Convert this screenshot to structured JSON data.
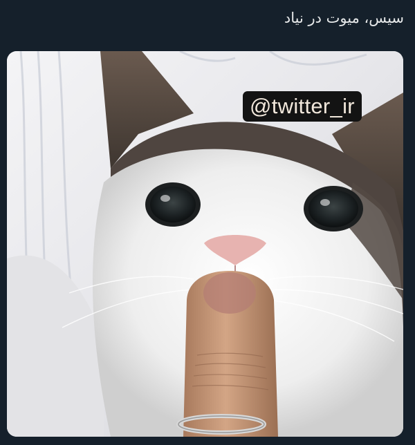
{
  "tweet": {
    "text": "سیس، میوت در نیاد"
  },
  "media": {
    "watermark_text": "@twitter_ir"
  }
}
